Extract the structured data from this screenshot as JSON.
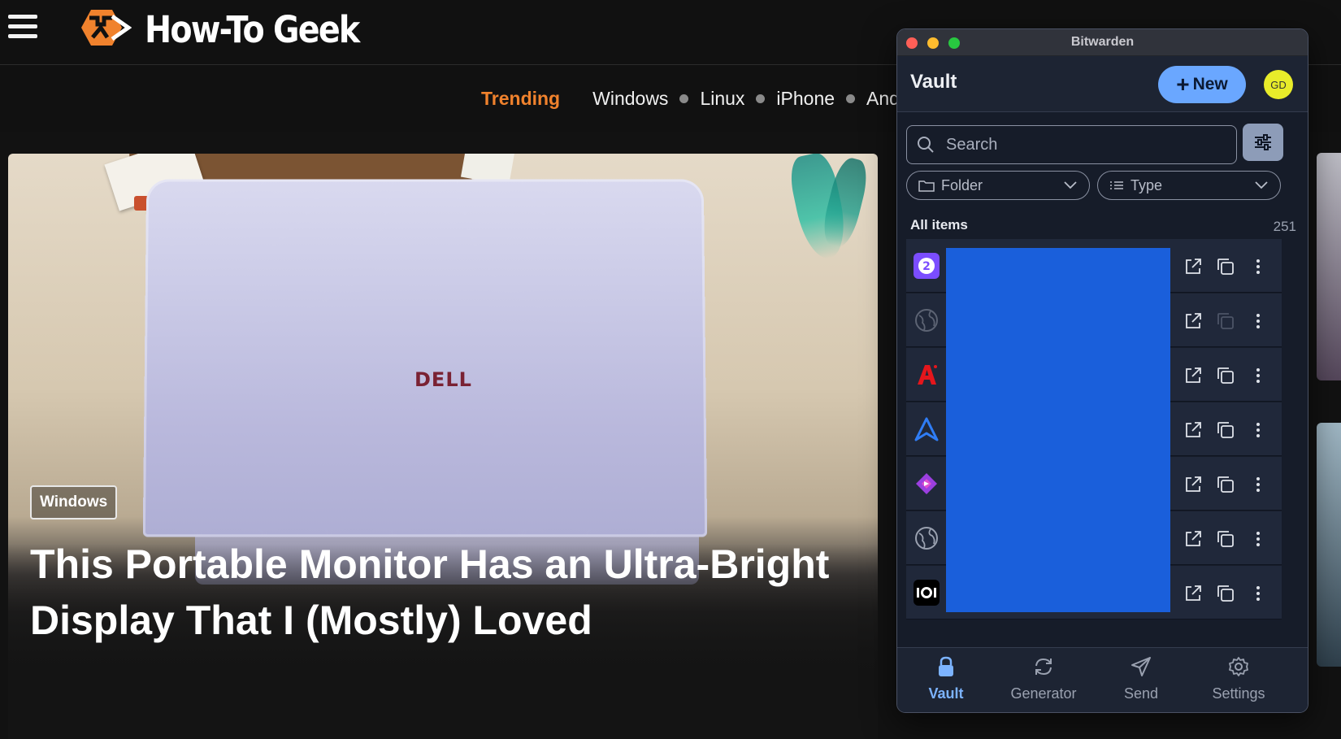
{
  "site": {
    "brand": "How-To Geek",
    "nav": {
      "trending": "Trending",
      "links": [
        "Windows",
        "Linux",
        "iPhone",
        "And"
      ]
    },
    "hero": {
      "badge": "Windows",
      "title": "This Portable Monitor Has an Ultra-Bright Display That I (Mostly) Loved",
      "laptop_logo": "DELL"
    }
  },
  "bitwarden": {
    "window_title": "Bitwarden",
    "header": {
      "title": "Vault",
      "new_label": "New",
      "avatar_initials": "GD",
      "avatar_color": "#e8ec2a"
    },
    "search": {
      "placeholder": "Search",
      "value": ""
    },
    "filters": {
      "folder_label": "Folder",
      "type_label": "Type"
    },
    "list": {
      "heading": "All items",
      "count": "251",
      "rows": [
        {
          "icon": "purple-2-app-icon"
        },
        {
          "icon": "globe-icon"
        },
        {
          "icon": "red-a-app-icon"
        },
        {
          "icon": "blue-arrow-app-icon"
        },
        {
          "icon": "purple-diamond-app-icon"
        },
        {
          "icon": "globe-icon"
        },
        {
          "icon": "black-ioi-app-icon"
        }
      ],
      "redaction_color": "#1a5fdb"
    },
    "bottom_nav": [
      {
        "label": "Vault",
        "active": true
      },
      {
        "label": "Generator",
        "active": false
      },
      {
        "label": "Send",
        "active": false
      },
      {
        "label": "Settings",
        "active": false
      }
    ],
    "accent_color": "#6aa7ff"
  }
}
